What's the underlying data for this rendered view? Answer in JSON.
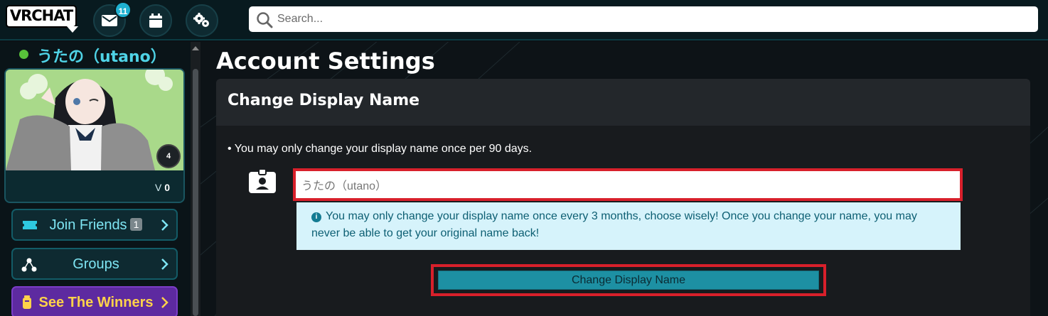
{
  "app": {
    "logo_text": "VRCHAT",
    "notification_count": "11",
    "search_placeholder": "Search..."
  },
  "topbar_icons": [
    "mail-icon",
    "calendar-icon",
    "settings-gears-icon",
    "search-icon"
  ],
  "sidebar": {
    "status_color": "#58c23a",
    "username": "うたの（utano）",
    "avatar_badge": "4",
    "avatar_stat": "0",
    "buttons": [
      {
        "label": "Join Friends",
        "count": "1",
        "icon": "ticket-icon"
      },
      {
        "label": "Groups",
        "icon": "groups-icon"
      },
      {
        "label": "See The Winners",
        "icon": "trophy-icon"
      }
    ]
  },
  "main": {
    "page_title": "Account Settings",
    "card_title": "Change Display Name",
    "note": "• You may only change your display name once per 90 days.",
    "name_input_value": "うたの（utano）",
    "warning": "You may only change your display name once every 3 months, choose wisely! Once you change your name, you may never be able to get your original name back!",
    "submit_label": "Change Display Name"
  },
  "colors": {
    "accent": "#1fb1d1",
    "highlight_border": "#d8202b",
    "button_teal": "#1d90a3",
    "warning_bg": "#d6f3fb"
  }
}
